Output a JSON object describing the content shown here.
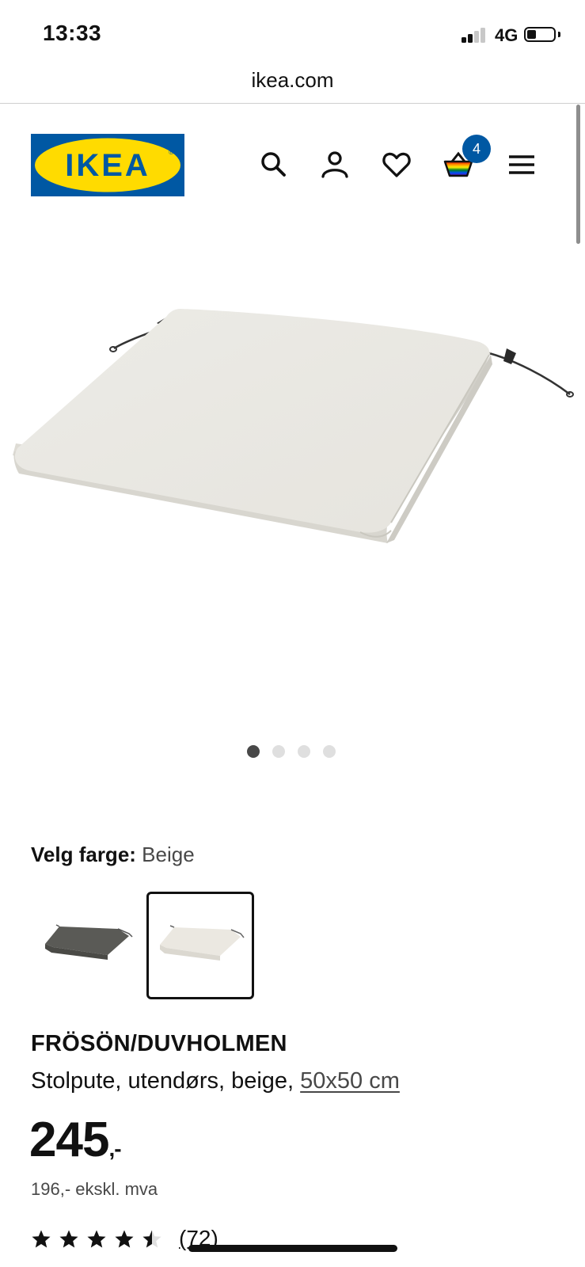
{
  "status_bar": {
    "time": "13:33",
    "network": "4G",
    "battery_level": 0.35
  },
  "browser": {
    "url": "ikea.com"
  },
  "header": {
    "logo_text": "IKEA",
    "cart_count": "4",
    "icons": [
      "search-icon",
      "account-icon",
      "heart-icon",
      "cart-icon",
      "menu-icon"
    ],
    "brand_colors": {
      "blue": "#0058a3",
      "yellow": "#ffdb00"
    }
  },
  "gallery": {
    "image_count": 4,
    "active_index": 0
  },
  "color_select": {
    "label": "Velg farge:",
    "value": "Beige",
    "options": [
      {
        "color": "#5a5a56",
        "selected": false
      },
      {
        "color": "#e9e5dc",
        "selected": true
      }
    ]
  },
  "product": {
    "name": "FRÖSÖN/DUVHOLMEN",
    "description": "Stolpute, utendørs, beige,",
    "measure": "50x50 cm",
    "price": "245",
    "price_suffix": ",-",
    "price_ex_vat": "196,- ekskl. mva",
    "rating": 4.5,
    "review_count": "(72)"
  }
}
